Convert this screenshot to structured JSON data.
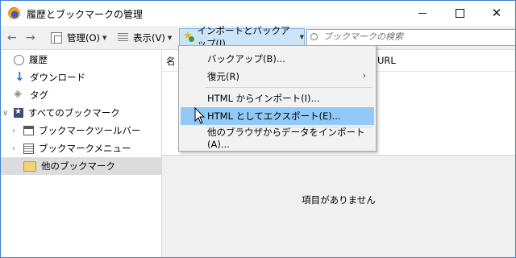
{
  "window": {
    "title": "履歴とブックマークの管理"
  },
  "toolbar": {
    "organize_label": "管理(O)",
    "views_label": "表示(V)",
    "import_label": "インポートとバックアップ(I)",
    "search_placeholder": "ブックマークの検索"
  },
  "sidebar": {
    "items": [
      {
        "label": "履歴",
        "icon": "clock-icon"
      },
      {
        "label": "ダウンロード",
        "icon": "download-icon"
      },
      {
        "label": "タグ",
        "icon": "tag-icon"
      },
      {
        "label": "すべてのブックマーク",
        "icon": "all-bookmarks-icon",
        "expanded": true
      },
      {
        "label": "ブックマークツールバー",
        "icon": "bookmarks-toolbar-icon",
        "expanded": false
      },
      {
        "label": "ブックマークメニュー",
        "icon": "bookmarks-menu-icon",
        "expanded": false
      },
      {
        "label": "他のブックマーク",
        "icon": "folder-icon",
        "selected": true
      }
    ]
  },
  "list": {
    "column_name": "名",
    "column_url": "URL",
    "empty_message": "項目がありません"
  },
  "menu": {
    "items": [
      {
        "label": "バックアップ(B)..."
      },
      {
        "label": "復元(R)",
        "has_submenu": true
      },
      {
        "label": "HTML からインポート(I)..."
      },
      {
        "label": "HTML としてエクスポート(E)...",
        "highlighted": true
      },
      {
        "label": "他のブラウザからデータをインポート(A)..."
      }
    ]
  },
  "colors": {
    "highlight": "#91c9f7",
    "toolbar_button_active": "#cce4f7",
    "window_border": "#3f7fd0"
  }
}
